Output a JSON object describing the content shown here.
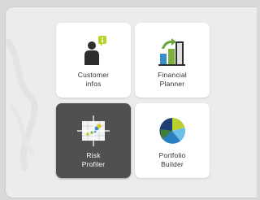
{
  "menu": {
    "tiles": [
      {
        "label": "Customer\ninfos",
        "icon": "customer-badge-icon",
        "active": false
      },
      {
        "label": "Financial\nPlanner",
        "icon": "bar-chart-growth-icon",
        "active": false
      },
      {
        "label": "Risk\nProfiler",
        "icon": "risk-grid-target-icon",
        "active": true
      },
      {
        "label": "Portfolio\nBuilder",
        "icon": "pie-chart-icon",
        "active": false
      }
    ]
  },
  "colors": {
    "background": "#d9d9d9",
    "panel": "#ececec",
    "tile": "#ffffff",
    "tile_active": "#505050",
    "badge_yellow": "#b9d12a",
    "bar_blue": "#3a8fc9",
    "bar_green": "#7db33a",
    "arrow_green": "#6aa63a"
  }
}
